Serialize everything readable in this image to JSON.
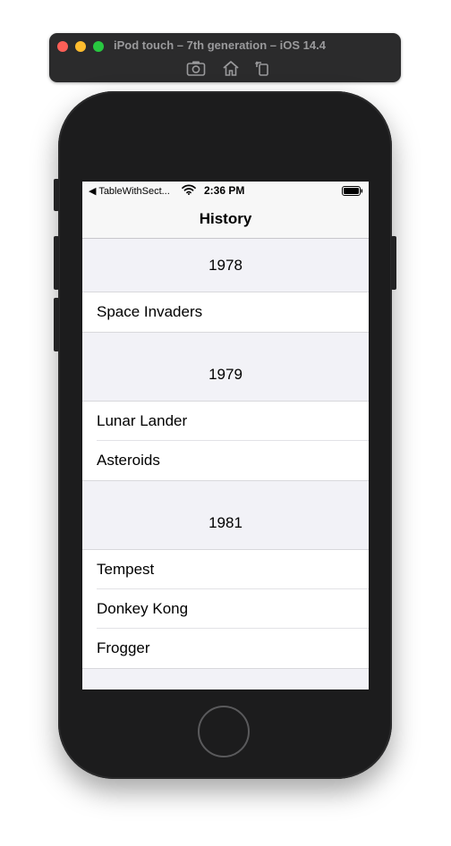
{
  "simulator": {
    "title": "iPod touch – 7th generation – iOS 14.4",
    "toolbar": [
      "screenshot-icon",
      "home-icon",
      "rotate-icon"
    ]
  },
  "status_bar": {
    "back_app": "◀ TableWithSect...",
    "time": "2:36 PM"
  },
  "nav": {
    "title": "History"
  },
  "sections": [
    {
      "header": "1978",
      "rows": [
        "Space Invaders"
      ]
    },
    {
      "header": "1979",
      "rows": [
        "Lunar Lander",
        "Asteroids"
      ]
    },
    {
      "header": "1981",
      "rows": [
        "Tempest",
        "Donkey Kong",
        "Frogger"
      ]
    }
  ]
}
